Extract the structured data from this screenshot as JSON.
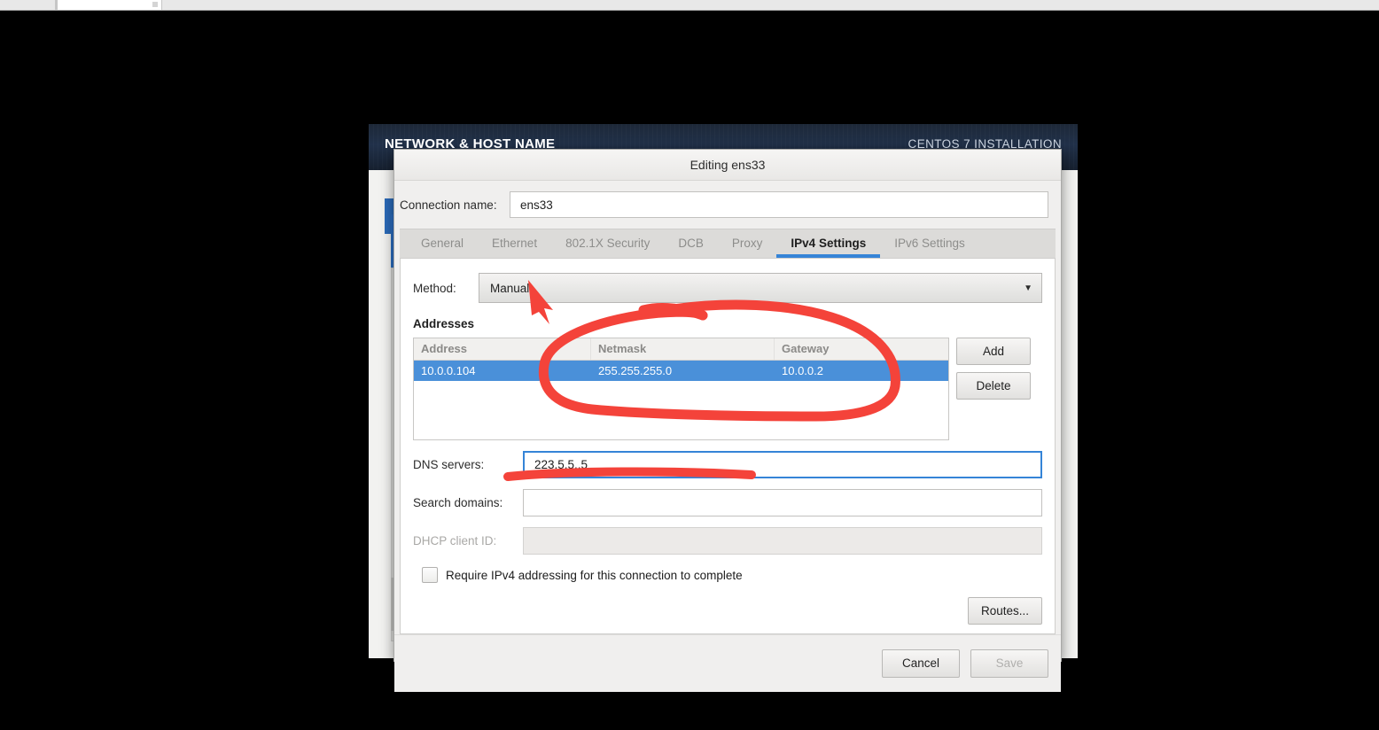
{
  "installer": {
    "page_title": "NETWORK & HOST NAME",
    "product_banner": "CENTOS 7 INSTALLATION"
  },
  "dialog": {
    "title": "Editing ens33",
    "connection_name_label": "Connection name:",
    "connection_name_value": "ens33",
    "tabs": [
      {
        "label": "General",
        "active": false
      },
      {
        "label": "Ethernet",
        "active": false
      },
      {
        "label": "802.1X Security",
        "active": false
      },
      {
        "label": "DCB",
        "active": false
      },
      {
        "label": "Proxy",
        "active": false
      },
      {
        "label": "IPv4 Settings",
        "active": true
      },
      {
        "label": "IPv6 Settings",
        "active": false
      }
    ],
    "method": {
      "label": "Method:",
      "selected": "Manual",
      "arrow_icon": "chevron-down-icon"
    },
    "addresses": {
      "section_title": "Addresses",
      "columns": [
        "Address",
        "Netmask",
        "Gateway"
      ],
      "rows": [
        {
          "address": "10.0.0.104",
          "netmask": "255.255.255.0",
          "gateway": "10.0.0.2",
          "selected": true
        }
      ],
      "add_label": "Add",
      "delete_label": "Delete"
    },
    "dns": {
      "label": "DNS servers:",
      "value": "223.5.5..5"
    },
    "search_domains": {
      "label": "Search domains:",
      "value": ""
    },
    "dhcp_client_id": {
      "label": "DHCP client ID:",
      "value": "",
      "disabled": true
    },
    "require_ipv4": {
      "label": "Require IPv4 addressing for this connection to complete",
      "checked": false
    },
    "routes_label": "Routes...",
    "cancel_label": "Cancel",
    "save_label": "Save",
    "save_disabled": true
  },
  "annotations": {
    "color": "#f4433a",
    "marks": [
      {
        "kind": "arrow",
        "points_to": "method-combo-value"
      },
      {
        "kind": "ellipse",
        "encircles": "addresses-table"
      },
      {
        "kind": "underline",
        "under": "dns-servers-input"
      }
    ]
  }
}
